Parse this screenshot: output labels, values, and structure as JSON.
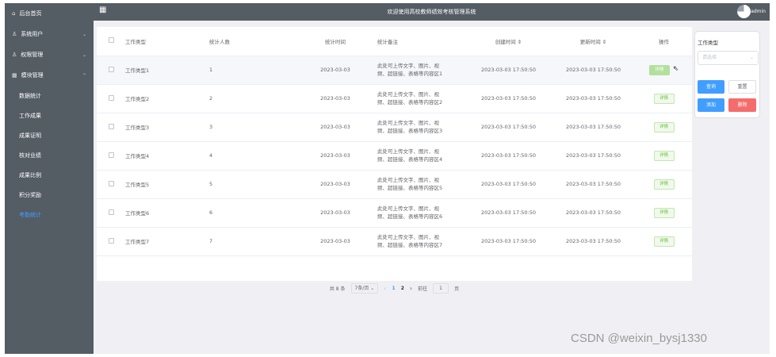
{
  "sidebar": {
    "items": [
      {
        "icon": "home-icon",
        "glyph": "⌂",
        "label": "后台首页",
        "arrow": ""
      },
      {
        "icon": "user-icon",
        "glyph": "♙",
        "label": "系统用户",
        "arrow": "⌄"
      },
      {
        "icon": "user-icon",
        "glyph": "♙",
        "label": "权限管理",
        "arrow": "⌄"
      },
      {
        "icon": "module-icon",
        "glyph": "▦",
        "label": "模块管理",
        "arrow": "⌃"
      }
    ],
    "subitems": [
      {
        "label": "数据统计",
        "active": false
      },
      {
        "label": "工作成果",
        "active": false
      },
      {
        "label": "成果证明",
        "active": false
      },
      {
        "label": "核对业绩",
        "active": false
      },
      {
        "label": "成果比例",
        "active": false
      },
      {
        "label": "积分奖励",
        "active": false
      },
      {
        "label": "考勤统计",
        "active": true
      }
    ]
  },
  "header": {
    "title": "欢迎使用高校教师绩效考核管理系统",
    "user": "admin"
  },
  "table": {
    "columns": [
      "",
      "工作类型",
      "统计人数",
      "统计时间",
      "统计备注",
      "创建时间 ⇕",
      "更新时间 ⇕",
      "操作"
    ],
    "detail_label": "详情",
    "rows": [
      {
        "type": "工作类型1",
        "count": "1",
        "date": "2023-03-03",
        "note1": "此处可上传文字、图片、视",
        "note2": "频、超链接、表格等内容区1",
        "created": "2023-03-03 17:50:50",
        "updated": "2023-03-03 17:50:50"
      },
      {
        "type": "工作类型2",
        "count": "2",
        "date": "2023-03-03",
        "note1": "此处可上传文字、图片、视",
        "note2": "频、超链接、表格等内容区2",
        "created": "2023-03-03 17:50:50",
        "updated": "2023-03-03 17:50:50"
      },
      {
        "type": "工作类型3",
        "count": "3",
        "date": "2023-03-03",
        "note1": "此处可上传文字、图片、视",
        "note2": "频、超链接、表格等内容区3",
        "created": "2023-03-03 17:50:50",
        "updated": "2023-03-03 17:50:50"
      },
      {
        "type": "工作类型4",
        "count": "4",
        "date": "2023-03-03",
        "note1": "此处可上传文字、图片、视",
        "note2": "频、超链接、表格等内容区4",
        "created": "2023-03-03 17:50:50",
        "updated": "2023-03-03 17:50:50"
      },
      {
        "type": "工作类型5",
        "count": "5",
        "date": "2023-03-03",
        "note1": "此处可上传文字、图片、视",
        "note2": "频、超链接、表格等内容区5",
        "created": "2023-03-03 17:50:50",
        "updated": "2023-03-03 17:50:50"
      },
      {
        "type": "工作类型6",
        "count": "6",
        "date": "2023-03-03",
        "note1": "此处可上传文字、图片、视",
        "note2": "频、超链接、表格等内容区6",
        "created": "2023-03-03 17:50:50",
        "updated": "2023-03-03 17:50:50"
      },
      {
        "type": "工作类型7",
        "count": "7",
        "date": "2023-03-03",
        "note1": "此处可上传文字、图片、视",
        "note2": "频、超链接、表格等内容区7",
        "created": "2023-03-03 17:50:50",
        "updated": "2023-03-03 17:50:50"
      }
    ]
  },
  "pagination": {
    "total": "共 8 条",
    "page_size": "7条/页 ⌄",
    "prev": "‹",
    "pages": [
      "1",
      "2"
    ],
    "active_page": "1",
    "next": "›",
    "goto_label": "前往",
    "goto_value": "1",
    "page_unit": "页"
  },
  "search": {
    "label": "工作类型",
    "placeholder": "请选择",
    "query_button": "查询",
    "reset_button": "重置",
    "add_button": "添加",
    "delete_button": "删除"
  },
  "watermark": "CSDN @weixin_bysj1330",
  "colors": {
    "sidebar_bg": "#545c64",
    "primary": "#409eff",
    "danger": "#f56c6c",
    "success": "#67c23a"
  }
}
